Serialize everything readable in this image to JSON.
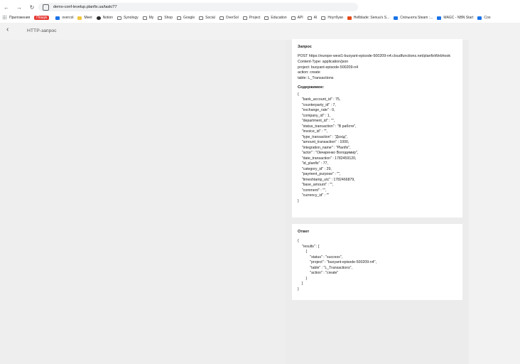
{
  "browser": {
    "url": "demo-conf-levelup.planfix.ua/task/77",
    "back_icon": "back-icon",
    "forward_icon": "forward-icon",
    "reload_icon": "reload-icon",
    "bookmarks": [
      {
        "label": "Приложения",
        "icon": "apps-icon"
      },
      {
        "label": "Пошук",
        "icon": "search-badge"
      },
      {
        "label": "overcol",
        "icon": "bookmark-icon"
      },
      {
        "label": "Meet",
        "icon": "bookmark-icon"
      },
      {
        "label": "Notion",
        "icon": "bookmark-icon"
      },
      {
        "label": "Synology",
        "icon": "folder-icon"
      },
      {
        "label": "My",
        "icon": "folder-icon"
      },
      {
        "label": "Shop",
        "icon": "folder-icon"
      },
      {
        "label": "Google",
        "icon": "folder-icon"
      },
      {
        "label": "Social",
        "icon": "folder-icon"
      },
      {
        "label": "OverSol",
        "icon": "folder-icon"
      },
      {
        "label": "Project",
        "icon": "folder-icon"
      },
      {
        "label": "Education",
        "icon": "folder-icon"
      },
      {
        "label": "API",
        "icon": "folder-icon"
      },
      {
        "label": "AI",
        "icon": "folder-icon"
      },
      {
        "label": "Ноутбуки",
        "icon": "folder-icon"
      },
      {
        "label": "Hellblade: Senua's S...",
        "icon": "bookmark-icon"
      },
      {
        "label": "Спільнота Steam :...",
        "icon": "bookmark-icon"
      },
      {
        "label": "MAGC - NBN Start",
        "icon": "bookmark-icon"
      },
      {
        "label": "Coo",
        "icon": "bookmark-icon"
      }
    ]
  },
  "page": {
    "title": "HTTP-запрос",
    "back_icon": "chevron-left-icon"
  },
  "request_card": {
    "heading": "Запрос",
    "lines": [
      "POST https://europe-west1-buoyant-episode-500209-n4.cloudfunctions.net/planfixWebhook",
      "Content-Type: application/json",
      "project: buoyant-episode-500209-n4",
      "action: create",
      "table: L_Transactions"
    ],
    "body_heading": "Содержимое:",
    "body_lines": [
      "{",
      "    \"bank_account_id\" : 75,",
      "    \"counterparty_id\" : 7,",
      "    \"exchange_rate\" : 0,",
      "    \"company_id\" : 1,",
      "    \"department_id\" : \"\",",
      "    \"status_transaction\" : \"В работе\",",
      "    \"invoice_id\" : \"\",",
      "    \"type_transaction\" : \"Дохід\",",
      "    \"amount_transaction\" : 1000,",
      "    \"integration_name\" : \"Planfix\",",
      "    \"actor\" : \"Овчаренко Володимир\",",
      "    \"date_transaction\" : 1782459120,",
      "    \"id_planfix\" : 77,",
      "    \"category_id\" : 29,",
      "    \"payment_purpose\" : \"\",",
      "    \"timeshtamp_utc\" : 1782466879,",
      "    \"base_amount\" : \"\",",
      "    \"comment\" : \"\",",
      "    \"currency_id\" : \"\"",
      "}"
    ]
  },
  "response_card": {
    "heading": "Ответ",
    "body_lines": [
      "{",
      "    \"results\" : [",
      "        {",
      "            \"status\" : \"success\",",
      "            \"project\" : \"buoyant-episode-500209-n4\",",
      "            \"table\" : \"L_Transactions\",",
      "            \"action\" : \"create\"",
      "        }",
      "    ]",
      "}"
    ]
  }
}
